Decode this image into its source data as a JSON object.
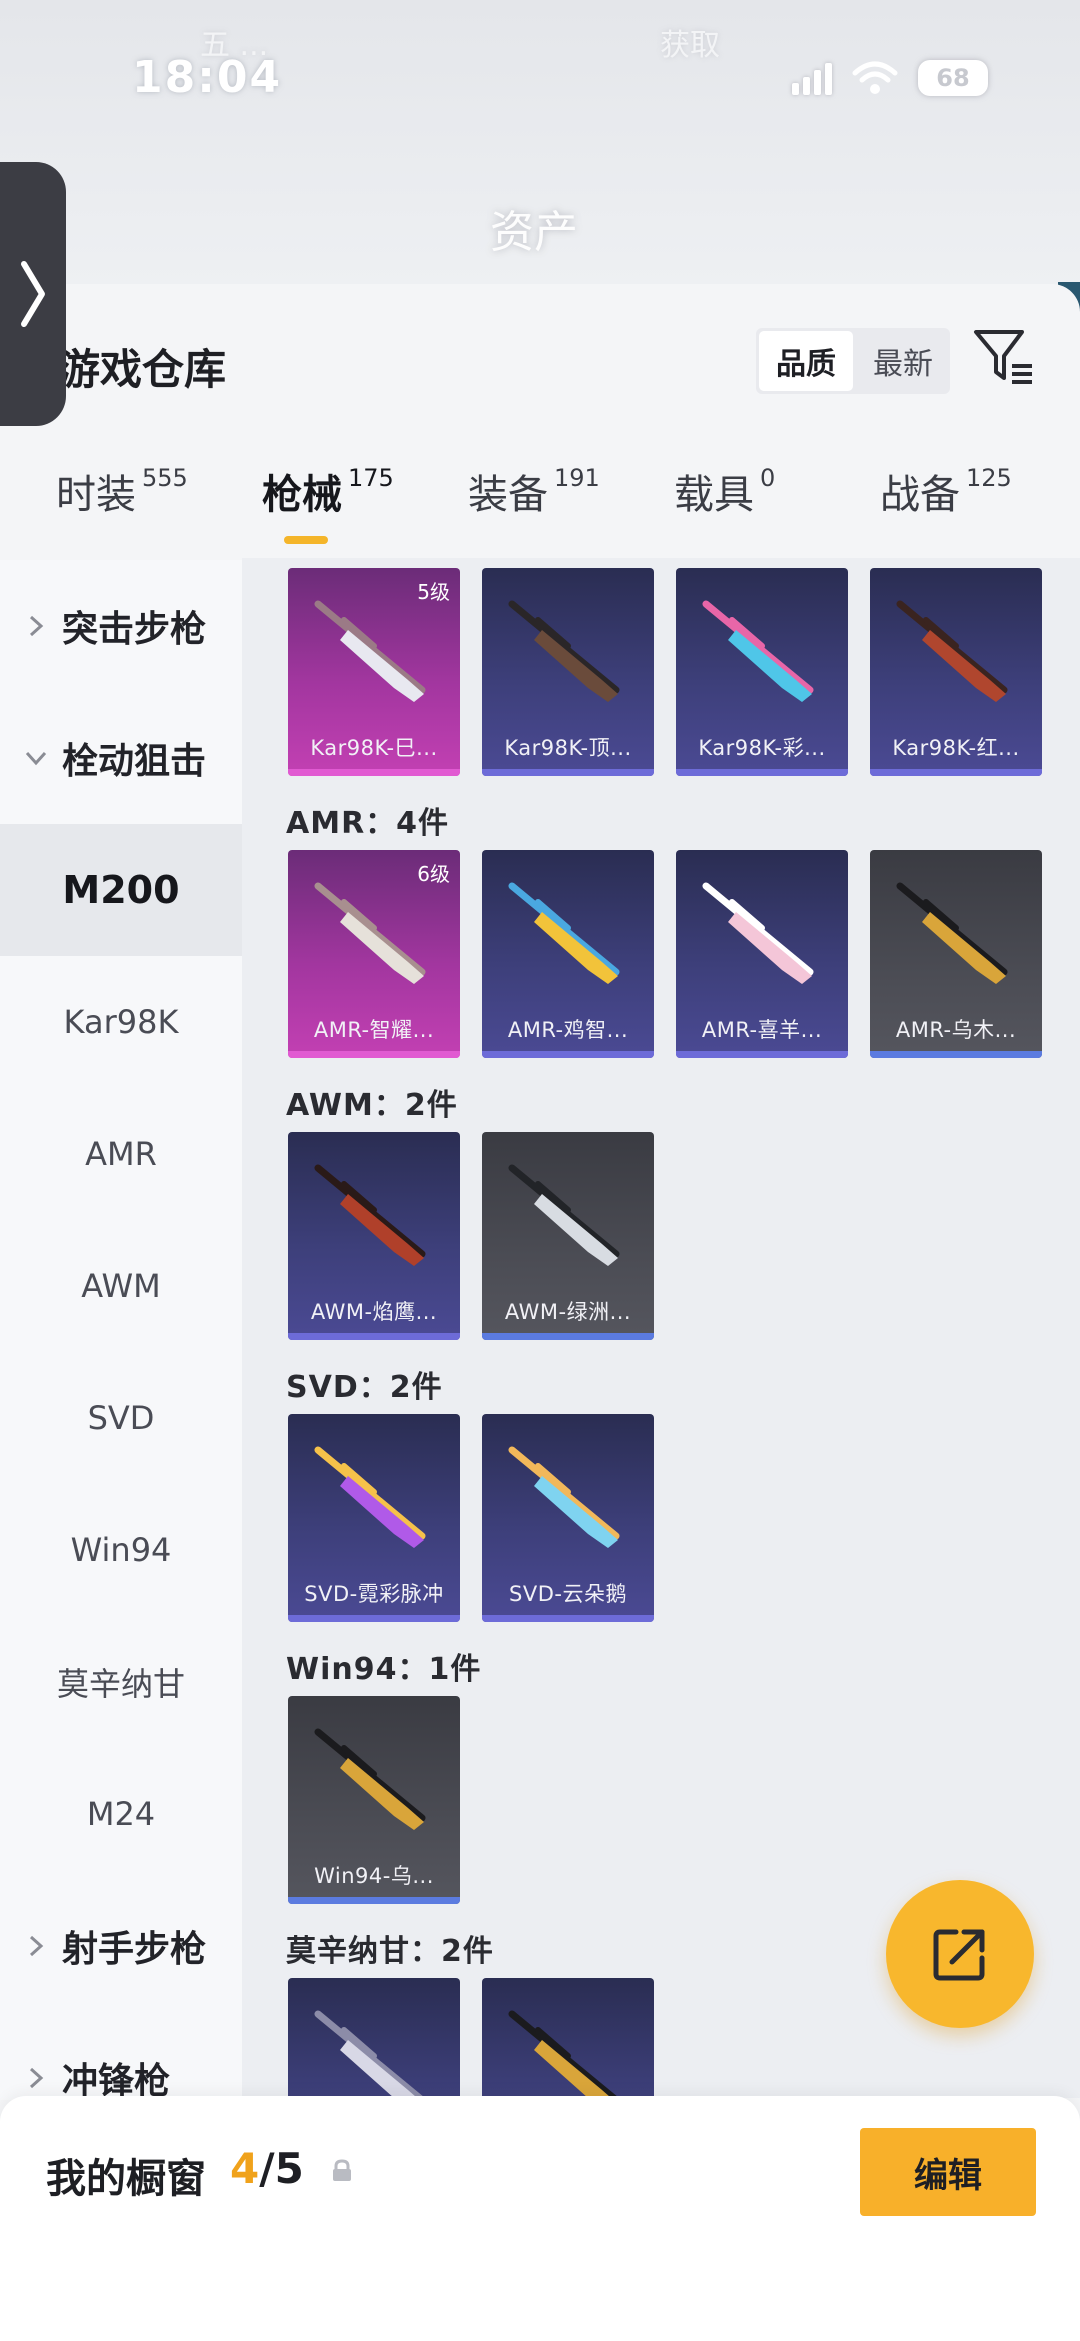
{
  "status_bar": {
    "time": "18:04",
    "blurred_left": "五 ...",
    "blurred_right": "获取",
    "battery": "68"
  },
  "header": {
    "title": "资产"
  },
  "panel": {
    "title": "游戏仓库",
    "sort_options": [
      "品质",
      "最新"
    ],
    "sort_active": "品质"
  },
  "tabs": [
    {
      "label": "时装",
      "count": "555"
    },
    {
      "label": "枪械",
      "count": "175"
    },
    {
      "label": "装备",
      "count": "191"
    },
    {
      "label": "载具",
      "count": "0"
    },
    {
      "label": "战备",
      "count": "125"
    }
  ],
  "categories": [
    {
      "label": "突击步枪",
      "type": "group",
      "expanded": false
    },
    {
      "label": "栓动狙击",
      "type": "group",
      "expanded": true
    },
    {
      "label": "M200",
      "type": "item",
      "selected": true
    },
    {
      "label": "Kar98K",
      "type": "item"
    },
    {
      "label": "AMR",
      "type": "item"
    },
    {
      "label": "AWM",
      "type": "item"
    },
    {
      "label": "SVD",
      "type": "item"
    },
    {
      "label": "Win94",
      "type": "item"
    },
    {
      "label": "莫辛纳甘",
      "type": "item"
    },
    {
      "label": "M24",
      "type": "item"
    },
    {
      "label": "射手步枪",
      "type": "group",
      "expanded": false
    },
    {
      "label": "冲锋枪",
      "type": "group",
      "expanded": false
    }
  ],
  "sections": [
    {
      "label": "",
      "items": [
        {
          "name": "Kar98K-巳...",
          "level": "5级",
          "rarity": "pink"
        },
        {
          "name": "Kar98K-顶...",
          "rarity": "purple"
        },
        {
          "name": "Kar98K-彩...",
          "rarity": "purple"
        },
        {
          "name": "Kar98K-红...",
          "rarity": "purple"
        }
      ]
    },
    {
      "label": "AMR：4件",
      "items": [
        {
          "name": "AMR-智耀...",
          "level": "6级",
          "rarity": "pink"
        },
        {
          "name": "AMR-鸡智...",
          "rarity": "purple"
        },
        {
          "name": "AMR-喜羊...",
          "rarity": "purple"
        },
        {
          "name": "AMR-乌木...",
          "rarity": "gray"
        }
      ]
    },
    {
      "label": "AWM：2件",
      "items": [
        {
          "name": "AWM-焰鹰...",
          "rarity": "purple"
        },
        {
          "name": "AWM-绿洲...",
          "rarity": "gray"
        }
      ]
    },
    {
      "label": "SVD：2件",
      "items": [
        {
          "name": "SVD-霓彩脉冲",
          "rarity": "purple"
        },
        {
          "name": "SVD-云朵鹅",
          "rarity": "purple"
        }
      ]
    },
    {
      "label": "Win94：1件",
      "items": [
        {
          "name": "Win94-乌...",
          "rarity": "gray"
        }
      ]
    },
    {
      "label": "莫辛纳甘：2件",
      "items": [
        {
          "name": "",
          "rarity": "purple"
        },
        {
          "name": "",
          "rarity": "purple"
        }
      ]
    }
  ],
  "bottom_bar": {
    "label": "我的橱窗",
    "current": "4",
    "total": "/5",
    "edit_label": "编辑"
  },
  "colors": {
    "accent": "#f8b02a",
    "pink_rarity": "#c340b3",
    "purple_rarity": "#4b4a94",
    "gray_rarity": "#4b4c54"
  }
}
